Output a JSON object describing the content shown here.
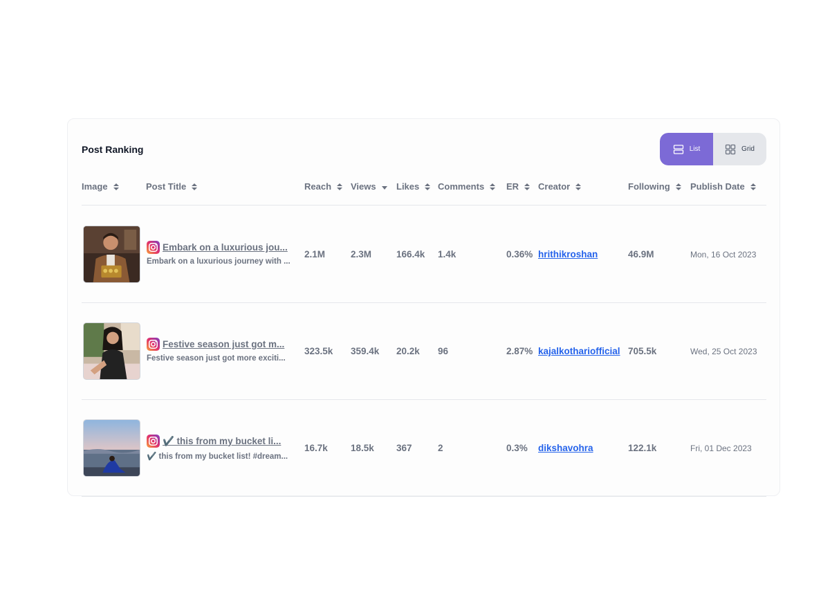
{
  "card": {
    "title": "Post Ranking"
  },
  "view_toggle": {
    "list_label": "List",
    "grid_label": "Grid",
    "selected": "List"
  },
  "columns": {
    "image": "Image",
    "post_title": "Post Title",
    "reach": "Reach",
    "views": "Views",
    "likes": "Likes",
    "comments": "Comments",
    "er": "ER",
    "creator": "Creator",
    "following": "Following",
    "publish_date": "Publish Date"
  },
  "rows": [
    {
      "title": "Embark on a luxurious jou...",
      "description": "Embark on a luxurious journey with ...",
      "reach": "2.1M",
      "views": "2.3M",
      "likes": "166.4k",
      "comments": "1.4k",
      "er": "0.36%",
      "creator": "hrithikroshan",
      "following": "46.9M",
      "publish_date": "Mon, 16 Oct 2023"
    },
    {
      "title": "Festive season just got m...",
      "description": "Festive season just got more exciti...",
      "reach": "323.5k",
      "views": "359.4k",
      "likes": "20.2k",
      "comments": "96",
      "er": "2.87%",
      "creator": "kajalkothariofficial",
      "following": "705.5k",
      "publish_date": "Wed, 25 Oct 2023"
    },
    {
      "title": "✔️ this from my bucket li...",
      "description": "✔️ this from my bucket list! #dream...",
      "reach": "16.7k",
      "views": "18.5k",
      "likes": "367",
      "comments": "2",
      "er": "0.3%",
      "creator": "dikshavohra",
      "following": "122.1k",
      "publish_date": "Fri, 01 Dec 2023"
    }
  ],
  "icons": {
    "platform": "instagram-icon",
    "list": "list-view-icon",
    "grid": "grid-view-icon",
    "sort": "sort-icon"
  },
  "colors": {
    "accent": "#7c6ad6",
    "link": "#2563eb",
    "toggle_bg": "#e5e7eb"
  }
}
